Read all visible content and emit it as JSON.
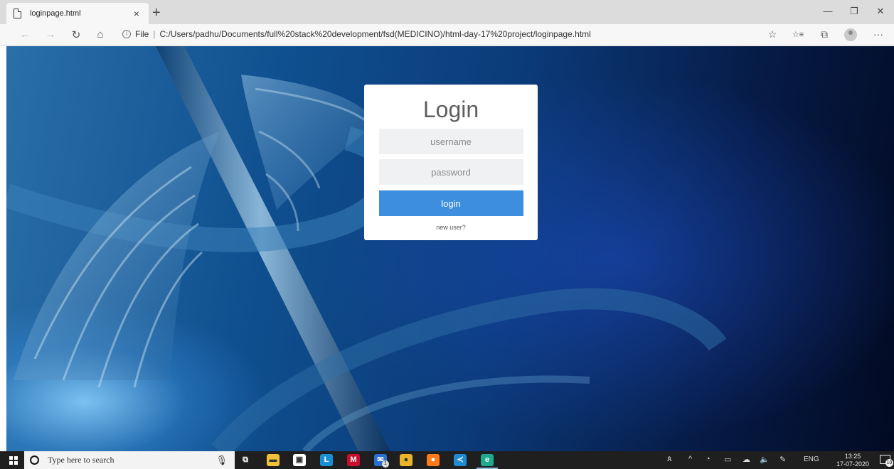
{
  "browser": {
    "tab_title": "loginpage.html",
    "tab_close": "×",
    "new_tab": "+",
    "minimize": "—",
    "restore": "❐",
    "close": "✕",
    "back": "←",
    "forward": "→",
    "refresh": "↻",
    "home": "⌂",
    "info": "i",
    "url_scheme": "File",
    "url_separator": "|",
    "url": "C:/Users/padhu/Documents/full%20stack%20development/fsd(MEDICINO)/html-day-17%20project/loginpage.html",
    "favorite": "☆",
    "favorites": "☆≡",
    "collections": "⧉",
    "more": "···"
  },
  "login": {
    "title": "Login",
    "username_placeholder": "username",
    "password_placeholder": "password",
    "button_label": "login",
    "new_user_label": "new user?",
    "accent_color": "#3d8ede"
  },
  "taskbar": {
    "search_placeholder": "Type here to search",
    "mic": "🎙",
    "language": "ENG",
    "time": "13:25",
    "date": "17-07-2020",
    "notification_count": "10",
    "mail_badge": "1",
    "app_icons": [
      {
        "name": "task-view-icon",
        "glyph": "⧉",
        "color": "transparent"
      },
      {
        "name": "file-explorer-icon",
        "glyph": "▬",
        "color": "#f0c23b"
      },
      {
        "name": "store-icon",
        "glyph": "▣",
        "color": "#ffffff"
      },
      {
        "name": "lens-app-icon",
        "glyph": "L",
        "color": "#1a8fd6"
      },
      {
        "name": "mcafee-icon",
        "glyph": "M",
        "color": "#c8102e"
      },
      {
        "name": "mail-icon",
        "glyph": "✉",
        "color": "#2b6fd1"
      },
      {
        "name": "chrome-icon",
        "glyph": "●",
        "color": "#e9b32a"
      },
      {
        "name": "firefox-icon",
        "glyph": "●",
        "color": "#ff7a1a"
      },
      {
        "name": "vscode-icon",
        "glyph": "≺",
        "color": "#1f8ad2"
      },
      {
        "name": "edge-icon",
        "glyph": "e",
        "color": "#1faa8f"
      }
    ],
    "tray_icons": [
      {
        "name": "people-icon",
        "glyph": "ጰ"
      },
      {
        "name": "chevron-up-icon",
        "glyph": "^"
      },
      {
        "name": "wifi-icon",
        "glyph": "◔"
      },
      {
        "name": "battery-icon",
        "glyph": "▭"
      },
      {
        "name": "onedrive-icon",
        "glyph": "☁"
      },
      {
        "name": "volume-icon",
        "glyph": "🔈"
      },
      {
        "name": "pen-icon",
        "glyph": "✎"
      }
    ]
  }
}
